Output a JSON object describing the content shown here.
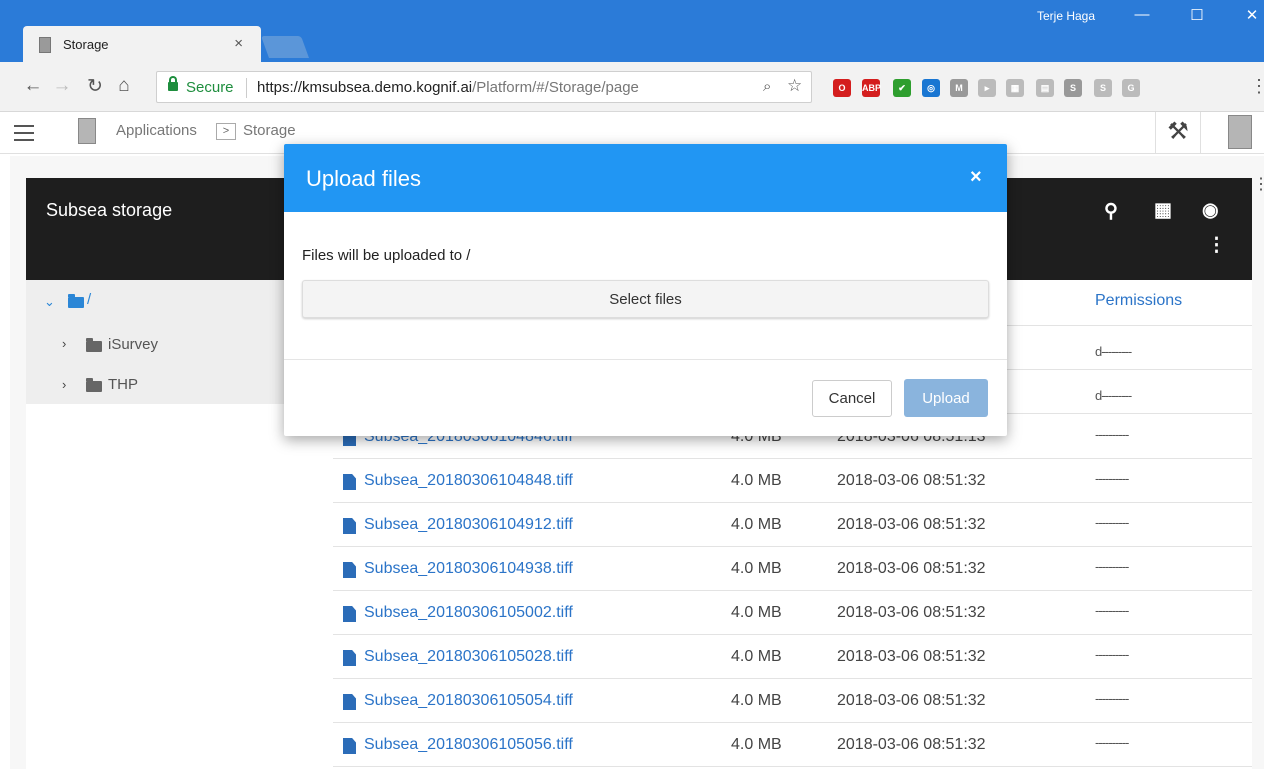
{
  "browser": {
    "tab_title": "Storage",
    "tab_close": "×",
    "user_name": "Terje Haga",
    "win_minimize": "—",
    "win_maximize": "☐",
    "win_close": "✕",
    "secure_label": "Secure",
    "url_base": "https://kmsubsea.demo.kognif.ai",
    "url_path": "/Platform/#/Storage/page",
    "extensions": [
      {
        "icon": "opera-icon",
        "color": "#d41e1e",
        "text": "O"
      },
      {
        "icon": "adblock-icon",
        "color": "#d41e1e",
        "text": "ABP"
      },
      {
        "icon": "checkmark-icon",
        "color": "#2e9e2e",
        "text": "✔"
      },
      {
        "icon": "chrome-ext-icon",
        "color": "#1976d2",
        "text": "◎"
      },
      {
        "icon": "gmail-icon",
        "color": "#999999",
        "text": "M"
      },
      {
        "icon": "cursor-icon",
        "color": "#bbbbbb",
        "text": "▸"
      },
      {
        "icon": "puzzle-icon",
        "color": "#bbbbbb",
        "text": "▦"
      },
      {
        "icon": "pdf-icon",
        "color": "#bbbbbb",
        "text": "▤"
      },
      {
        "icon": "s-ext-icon",
        "color": "#999999",
        "text": "S"
      },
      {
        "icon": "skype-icon",
        "color": "#bbbbbb",
        "text": "S"
      },
      {
        "icon": "g-ext-icon",
        "color": "#bbbbbb",
        "text": "G"
      }
    ]
  },
  "app": {
    "breadcrumb": [
      "Applications",
      "Storage"
    ],
    "breadcrumb_sep": ">"
  },
  "storage": {
    "title": "Subsea storage",
    "tree": {
      "root": "/",
      "children": [
        "iSurvey",
        "THP"
      ]
    },
    "columns": {
      "permissions": "Permissions"
    },
    "folder_perms": [
      "d---------",
      "d---------"
    ],
    "files": [
      {
        "name": "Subsea_20180306104846.tiff",
        "size": "4.0 MB",
        "date": "2018-03-06 08:51:13",
        "perm": "----------"
      },
      {
        "name": "Subsea_20180306104848.tiff",
        "size": "4.0 MB",
        "date": "2018-03-06 08:51:32",
        "perm": "----------"
      },
      {
        "name": "Subsea_20180306104912.tiff",
        "size": "4.0 MB",
        "date": "2018-03-06 08:51:32",
        "perm": "----------"
      },
      {
        "name": "Subsea_20180306104938.tiff",
        "size": "4.0 MB",
        "date": "2018-03-06 08:51:32",
        "perm": "----------"
      },
      {
        "name": "Subsea_20180306105002.tiff",
        "size": "4.0 MB",
        "date": "2018-03-06 08:51:32",
        "perm": "----------"
      },
      {
        "name": "Subsea_20180306105028.tiff",
        "size": "4.0 MB",
        "date": "2018-03-06 08:51:32",
        "perm": "----------"
      },
      {
        "name": "Subsea_20180306105054.tiff",
        "size": "4.0 MB",
        "date": "2018-03-06 08:51:32",
        "perm": "----------"
      },
      {
        "name": "Subsea_20180306105056.tiff",
        "size": "4.0 MB",
        "date": "2018-03-06 08:51:32",
        "perm": "----------"
      }
    ]
  },
  "modal": {
    "title": "Upload files",
    "close": "×",
    "message": "Files will be uploaded to /",
    "select_label": "Select files",
    "cancel_label": "Cancel",
    "upload_label": "Upload"
  },
  "colors": {
    "title_bar": "#2b7bd8",
    "modal_header": "#2196f3",
    "link": "#2b74c8",
    "upload_disabled": "#8ab4dd",
    "storage_header": "#1e1e1e"
  }
}
